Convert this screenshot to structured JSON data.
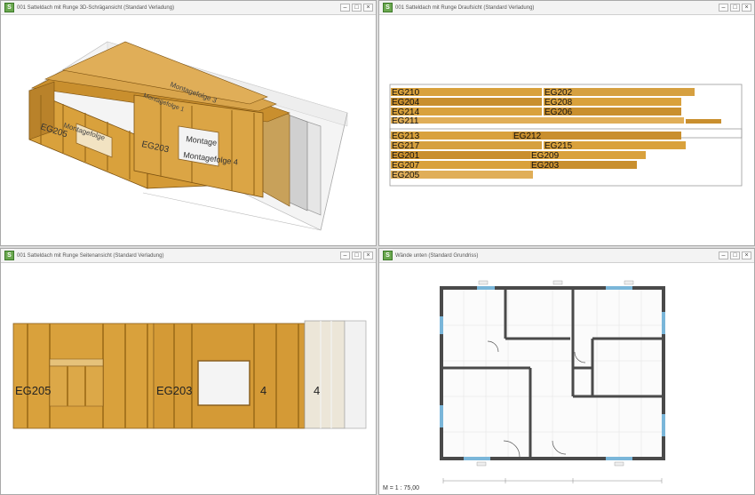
{
  "windows": {
    "tl": {
      "title": "001 Satteldach mit Runge 3D-Schrägansicht (Standard Verladung)"
    },
    "tr": {
      "title": "001 Satteldach mit Runge Draufsicht (Standard Verladung)"
    },
    "bl": {
      "title": "001 Satteldach mit Runge Seitenansicht (Standard Verladung)"
    },
    "br": {
      "title": "Wände unten (Standard Grundriss)"
    }
  },
  "controls": {
    "minimize": "–",
    "maximize": "□",
    "close": "×"
  },
  "view3d": {
    "labels": [
      "EG205",
      "EG203",
      "Montage",
      "Montagefolge 4",
      "Montagefolge",
      "Montagefolge 3",
      "Montagefolge 1"
    ]
  },
  "topview": {
    "rows_group1": [
      {
        "left": "EG210",
        "right": "EG202"
      },
      {
        "left": "EG204",
        "right": "EG208"
      },
      {
        "left": "EG214",
        "right": "EG206"
      },
      {
        "left": "EG211",
        "right": ""
      }
    ],
    "rows_group2": [
      {
        "left": "EG213",
        "right": "EG212"
      },
      {
        "left": "EG217",
        "right": "EG215"
      },
      {
        "left": "EG201",
        "right": "EG209"
      },
      {
        "left": "EG207",
        "right": "EG203"
      },
      {
        "left": "EG205",
        "right": ""
      }
    ]
  },
  "sideview": {
    "labels": [
      "EG205",
      "EG203",
      "4",
      "4"
    ]
  },
  "floorplan": {
    "scale": "M = 1 : 75,00"
  },
  "colors": {
    "osb": "#d9a13c",
    "timber": "#c98f2e",
    "wall": "#4a4a4a",
    "window": "#7ab6d9"
  }
}
